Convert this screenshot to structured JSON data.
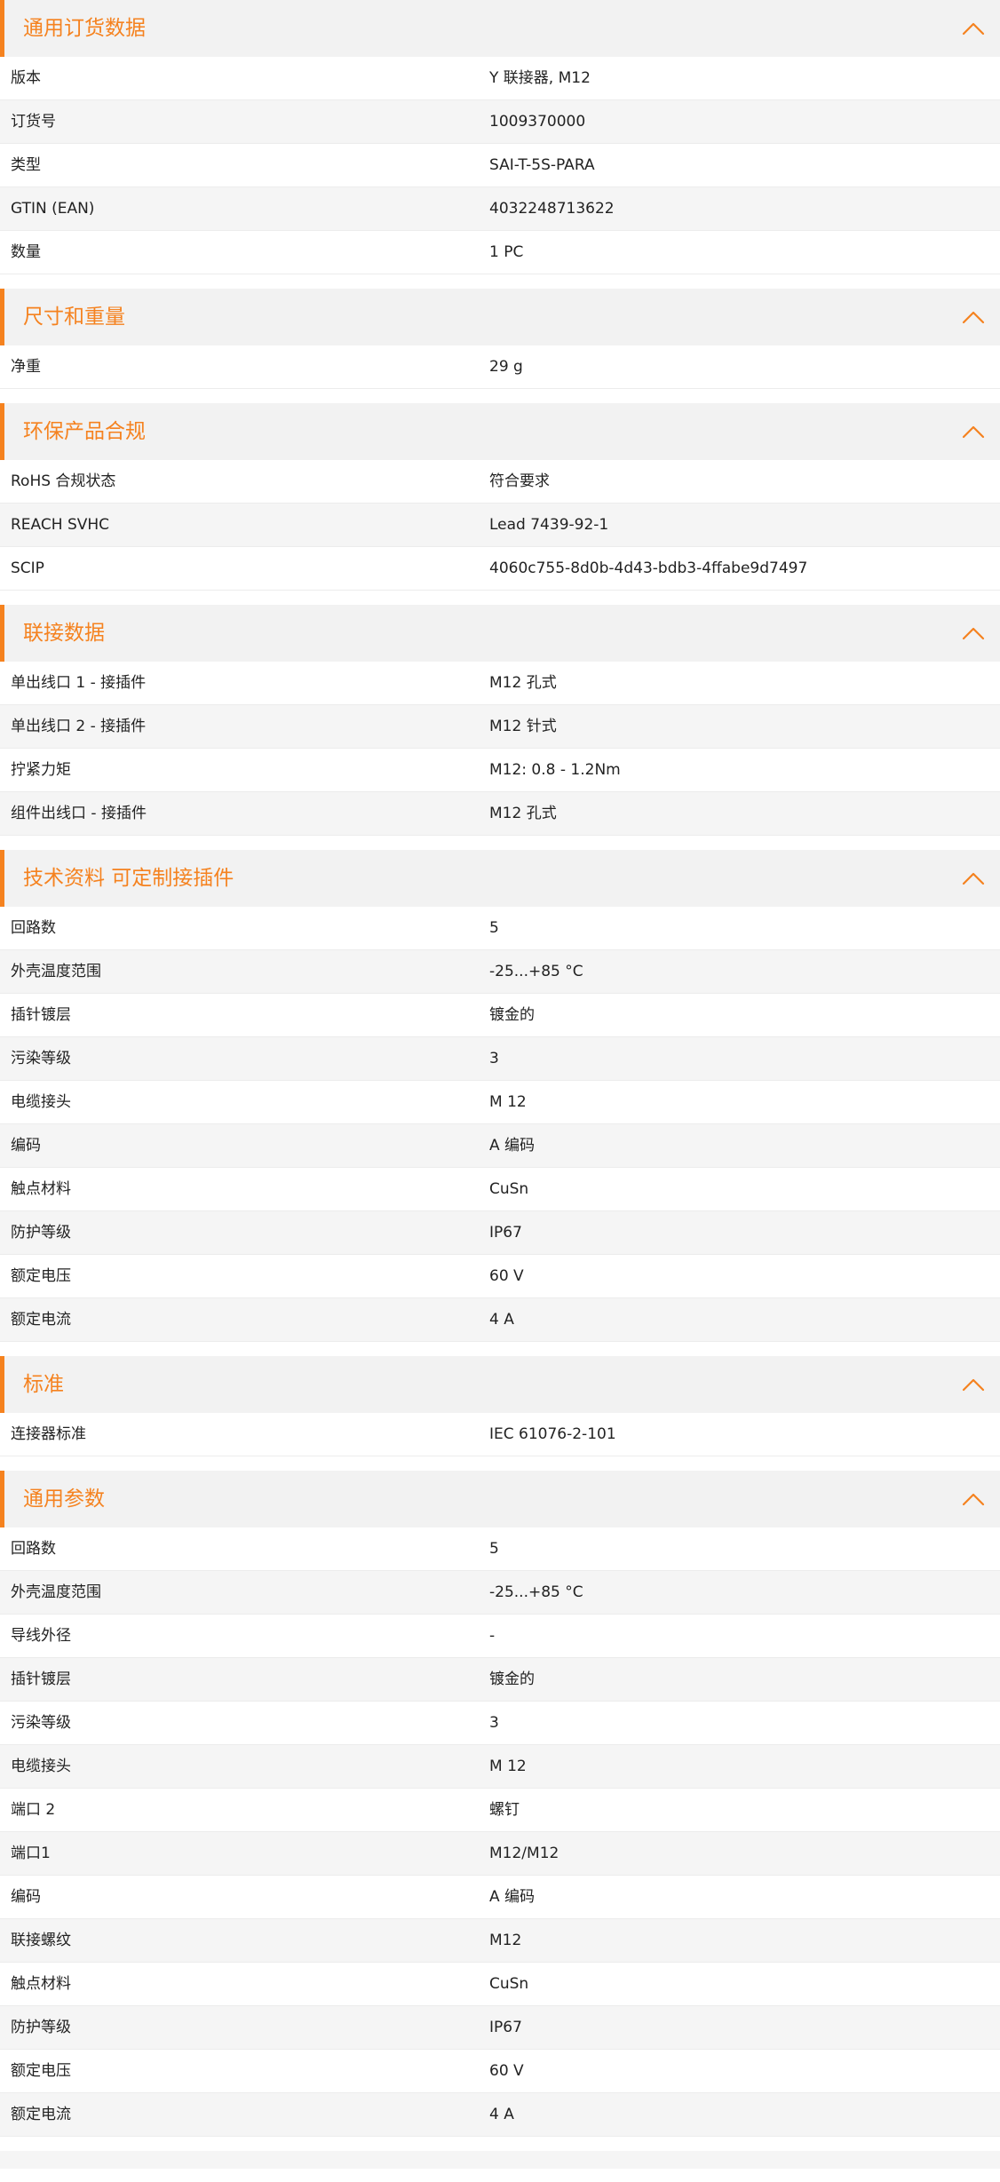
{
  "accent_color": "#f5821f",
  "collapse_icon": "chevron-up-icon",
  "sections": [
    {
      "id": "ordering",
      "title": "通用订货数据",
      "rows": [
        {
          "label": "版本",
          "value": "Y 联接器, M12"
        },
        {
          "label": "订货号",
          "value": "1009370000"
        },
        {
          "label": "类型",
          "value": "SAI-T-5S-PARA"
        },
        {
          "label": "GTIN (EAN)",
          "value": "4032248713622"
        },
        {
          "label": "数量",
          "value": "1  PC"
        }
      ]
    },
    {
      "id": "dimensions",
      "title": "尺寸和重量",
      "rows": [
        {
          "label": "净重",
          "value": "29  g"
        }
      ]
    },
    {
      "id": "environmental",
      "title": "环保产品合规",
      "rows": [
        {
          "label": "RoHS 合规状态",
          "value": "符合要求"
        },
        {
          "label": "REACH SVHC",
          "value": "Lead 7439-92-1"
        },
        {
          "label": "SCIP",
          "value": "4060c755-8d0b-4d43-bdb3-4ffabe9d7497"
        }
      ]
    },
    {
      "id": "connection",
      "title": "联接数据",
      "rows": [
        {
          "label": "单出线口 1 - 接插件",
          "value": "M12 孔式"
        },
        {
          "label": "单出线口 2 - 接插件",
          "value": "M12 针式"
        },
        {
          "label": "拧紧力矩",
          "value": "M12: 0.8 - 1.2Nm"
        },
        {
          "label": "组件出线口 - 接插件",
          "value": "M12 孔式"
        }
      ]
    },
    {
      "id": "technical",
      "title": "技术资料 可定制接插件",
      "rows": [
        {
          "label": "回路数",
          "value": "5"
        },
        {
          "label": "外壳温度范围",
          "value": "-25...+85 °C"
        },
        {
          "label": "插针镀层",
          "value": "镀金的"
        },
        {
          "label": "污染等级",
          "value": "3"
        },
        {
          "label": "电缆接头",
          "value": "M 12"
        },
        {
          "label": "编码",
          "value": "A 编码"
        },
        {
          "label": "触点材料",
          "value": "CuSn"
        },
        {
          "label": "防护等级",
          "value": "IP67"
        },
        {
          "label": "额定电压",
          "value": "60  V"
        },
        {
          "label": "额定电流",
          "value": "4  A"
        }
      ]
    },
    {
      "id": "standards",
      "title": "标准",
      "rows": [
        {
          "label": "连接器标准",
          "value": "IEC 61076-2-101"
        }
      ]
    },
    {
      "id": "general",
      "title": "通用参数",
      "rows": [
        {
          "label": "回路数",
          "value": "5"
        },
        {
          "label": "外壳温度范围",
          "value": "-25...+85 °C"
        },
        {
          "label": "导线外径",
          "value": "-"
        },
        {
          "label": "插针镀层",
          "value": "镀金的"
        },
        {
          "label": "污染等级",
          "value": "3"
        },
        {
          "label": "电缆接头",
          "value": "M 12"
        },
        {
          "label": "端口 2",
          "value": "螺钉"
        },
        {
          "label": "端口1",
          "value": "M12/M12"
        },
        {
          "label": "编码",
          "value": "A 编码"
        },
        {
          "label": "联接螺纹",
          "value": "M12"
        },
        {
          "label": "触点材料",
          "value": "CuSn"
        },
        {
          "label": "防护等级",
          "value": "IP67"
        },
        {
          "label": "额定电压",
          "value": "60  V"
        },
        {
          "label": "额定电流",
          "value": "4  A"
        }
      ]
    }
  ]
}
